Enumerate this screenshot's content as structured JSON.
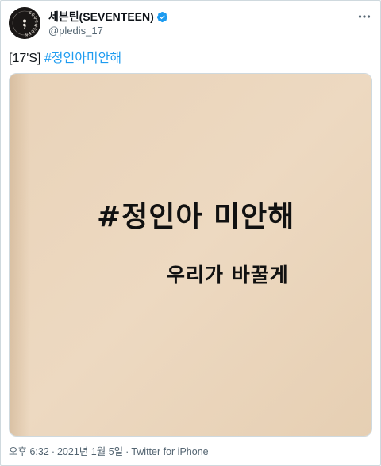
{
  "author": {
    "display_name": "세븐틴(SEVENTEEN)",
    "handle": "@pledis_17",
    "avatar_text": "SEVENTEEN",
    "verified": true
  },
  "tweet": {
    "prefix": "[17'S]",
    "hashtag": "#정인아미안해"
  },
  "media": {
    "line1": "#정인아 미안해",
    "line2": "우리가 바꿀게"
  },
  "meta": {
    "time": "오후 6:32",
    "date": "2021년 1월 5일",
    "separator": "·",
    "source": "Twitter for iPhone"
  },
  "colors": {
    "accent": "#1d9bf0",
    "paper": "#ecd7be",
    "ink": "#111111",
    "avatar_bg": "#1a1716"
  },
  "icons": {
    "verified": "verified-badge-icon",
    "more": "more-options-icon"
  }
}
